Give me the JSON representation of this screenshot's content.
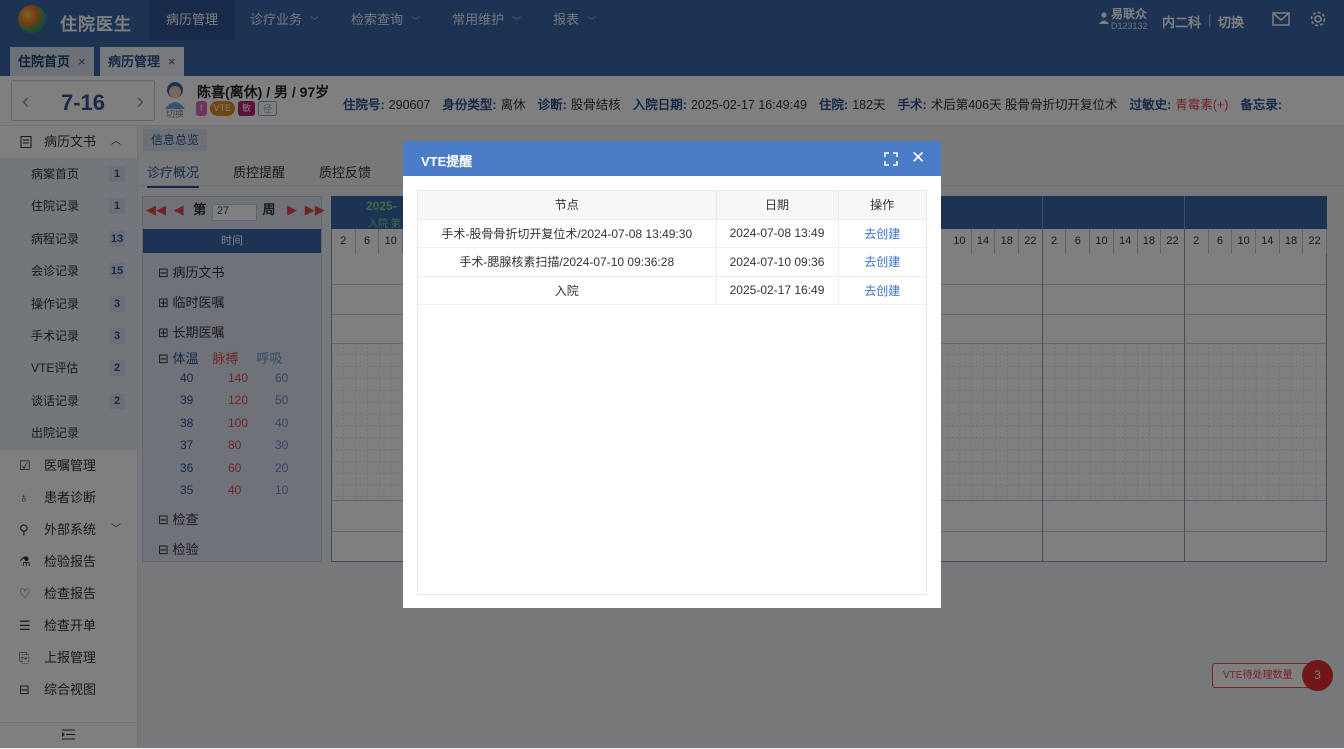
{
  "app": {
    "name": "住院医生"
  },
  "nav": [
    {
      "label": "病历管理",
      "chevron": false
    },
    {
      "label": "诊疗业务",
      "chevron": true
    },
    {
      "label": "检索查询",
      "chevron": true
    },
    {
      "label": "常用维护",
      "chevron": true
    },
    {
      "label": "报表",
      "chevron": true
    }
  ],
  "user": {
    "name": "易联众",
    "id": "D123132",
    "dept": "内二科",
    "switch": "切换"
  },
  "tabs": [
    {
      "label": "住院首页",
      "close": "×"
    },
    {
      "label": "病历管理",
      "close": "×"
    }
  ],
  "day": {
    "value": "7-16",
    "prev": "‹",
    "next": "›"
  },
  "patient": {
    "avatar_label": "切换",
    "name": "陈喜(离休) / 男 / 97岁",
    "badges": [
      {
        "text": "I",
        "color": "#d96bc1"
      },
      {
        "text": "VTE",
        "color": "#e08a1e"
      },
      {
        "text": "敏",
        "color": "#b5216e"
      },
      {
        "text": "径",
        "color": "#8aa3c7"
      }
    ],
    "info": [
      {
        "k": "住院号:",
        "v": "290607"
      },
      {
        "k": "身份类型:",
        "v": "离休"
      },
      {
        "k": "诊断:",
        "v": "股骨结核"
      },
      {
        "k": "入院日期:",
        "v": "2025-02-17 16:49:49"
      },
      {
        "k": "住院:",
        "v": "182天"
      },
      {
        "k": "手术:",
        "v": "术后第406天 股骨骨折切开复位术"
      },
      {
        "k": "过敏史:",
        "v": "青霉素(+)",
        "red": true
      },
      {
        "k": "备忘录:",
        "v": ""
      }
    ]
  },
  "sidebar": {
    "group_doc": "病历文书",
    "subs": [
      {
        "label": "病案首页",
        "count": "1"
      },
      {
        "label": "住院记录",
        "count": "1"
      },
      {
        "label": "病程记录",
        "count": "13"
      },
      {
        "label": "会诊记录",
        "count": "15"
      },
      {
        "label": "操作记录",
        "count": "3"
      },
      {
        "label": "手术记录",
        "count": "3"
      },
      {
        "label": "VTE评估",
        "count": "2"
      },
      {
        "label": "谈话记录",
        "count": "2"
      },
      {
        "label": "出院记录",
        "count": ""
      }
    ],
    "groups": [
      "医嘱管理",
      "患者诊断",
      "外部系统",
      "检验报告",
      "检查报告",
      "检查开单",
      "上报管理",
      "综合视图"
    ]
  },
  "main": {
    "info_tab": "信息总览",
    "tabs": [
      "诊疗概况",
      "质控提醒",
      "质控反馈"
    ],
    "week": {
      "prefix": "第",
      "value": "27",
      "suffix": "周"
    },
    "time_header": "时间",
    "rows": [
      "病历文书",
      "临时医嘱",
      "长期医嘱"
    ],
    "vitals_header": [
      "体温",
      "脉搏",
      "呼吸"
    ],
    "vitals": [
      [
        "40",
        "140",
        "60"
      ],
      [
        "39",
        "120",
        "50"
      ],
      [
        "38",
        "100",
        "40"
      ],
      [
        "37",
        "80",
        "30"
      ],
      [
        "36",
        "60",
        "20"
      ],
      [
        "35",
        "40",
        "10"
      ]
    ],
    "rows_bottom": [
      "检查",
      "检验"
    ],
    "chart_year": "2025-",
    "chart_sub": "入院 第",
    "hours_a": [
      "2",
      "6",
      "10"
    ],
    "hours_b": [
      "10",
      "14",
      "18",
      "22",
      "2",
      "6",
      "10",
      "14",
      "18",
      "22",
      "2",
      "6",
      "10",
      "14",
      "18",
      "22"
    ]
  },
  "dialog": {
    "title": "VTE提醒",
    "columns": [
      "节点",
      "日期",
      "操作"
    ],
    "rows": [
      {
        "node": "手术-股骨骨折切开复位术/2024-07-08 13:49:30",
        "date": "2024-07-08 13:49",
        "action": "去创建"
      },
      {
        "node": "手术-腮腺核素扫描/2024-07-10 09:36:28",
        "date": "2024-07-10 09:36",
        "action": "去创建"
      },
      {
        "node": "入院",
        "date": "2025-02-17 16:49",
        "action": "去创建"
      }
    ]
  },
  "vte_pending": {
    "label": "VTE待处理数量",
    "count": "3"
  }
}
